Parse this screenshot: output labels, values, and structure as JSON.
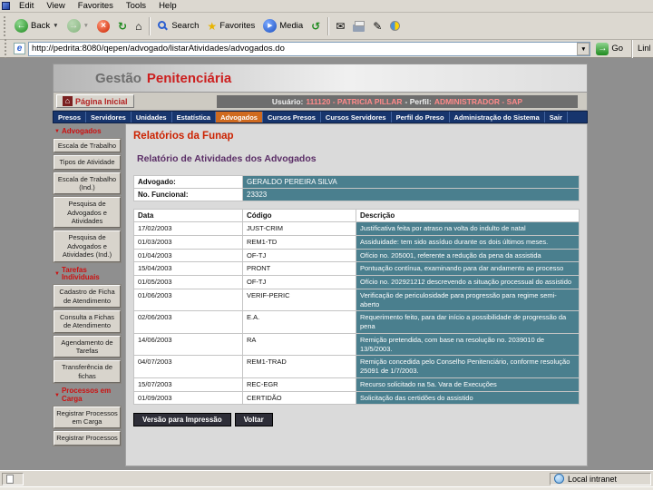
{
  "icons": {
    "back": "←",
    "forward": "→",
    "stop": "×",
    "refresh": "↻",
    "home": "⌂",
    "star": "★",
    "media": "▶",
    "history": "↺",
    "mail": "✉",
    "edit": "✎",
    "dropdown": "▼",
    "go": "→",
    "ie": "e",
    "section_arrow": "▼"
  },
  "browser": {
    "menu": [
      "Edit",
      "View",
      "Favorites",
      "Tools",
      "Help"
    ],
    "toolbar": {
      "back": "Back",
      "search": "Search",
      "favorites": "Favorites",
      "media": "Media"
    },
    "address": {
      "url": "http://pedrita:8080/qepen/advogado/listarAtividades/advogados.do",
      "go": "Go",
      "links": "Links"
    },
    "status": {
      "zone": "Local intranet"
    }
  },
  "app": {
    "brand": {
      "part1": "Gestão",
      "part2": "Penitenciária"
    },
    "home_link": "Página Inicial",
    "user_bar": {
      "label1": "Usuário:",
      "value1": "111120 - PATRICIA PILLAR",
      "label2": "- Perfil:",
      "value2": "ADMINISTRADOR - SAP"
    },
    "nav_tabs": [
      {
        "label": "Presos",
        "active": false
      },
      {
        "label": "Servidores",
        "active": false
      },
      {
        "label": "Unidades",
        "active": false
      },
      {
        "label": "Estatística",
        "active": false
      },
      {
        "label": "Advogados",
        "active": true
      },
      {
        "label": "Cursos Presos",
        "active": false
      },
      {
        "label": "Cursos Servidores",
        "active": false
      },
      {
        "label": "Perfil do Preso",
        "active": false
      },
      {
        "label": "Administração do Sistema",
        "active": false
      },
      {
        "label": "Sair",
        "active": false
      }
    ]
  },
  "sidebar": {
    "sections": [
      {
        "header": "Advogados",
        "items": [
          "Escala de Trabalho",
          "Tipos de Atividade",
          "Escala de Trabalho (Ind.)",
          "Pesquisa de Advogados e Atividades",
          "Pesquisa de Advogados e Atividades (Ind.)"
        ]
      },
      {
        "header": "Tarefas Individuais",
        "items": [
          "Cadastro de Ficha de Atendimento",
          "Consulta a Fichas de Atendimento",
          "Agendamento de Tarefas",
          "Transferência de fichas"
        ]
      },
      {
        "header": "Processos em Carga",
        "items": [
          "Registrar Processos em Carga",
          "Registrar Processos"
        ]
      }
    ]
  },
  "report": {
    "section_title": "Relatórios da Funap",
    "title": "Relatório de Atividades dos Advogados",
    "fields": [
      {
        "label": "Advogado:",
        "value": "GERALDO PEREIRA SILVA"
      },
      {
        "label": "No. Funcional:",
        "value": "23323"
      }
    ],
    "table": {
      "headers": [
        "Data",
        "Código",
        "Descrição"
      ],
      "rows": [
        [
          "17/02/2003",
          "JUST-CRIM",
          "Justificativa feita por atraso na volta do indulto de natal"
        ],
        [
          "01/03/2003",
          "REM1-TD",
          "Assiduidade: tem sido assíduo durante os dois últimos meses."
        ],
        [
          "01/04/2003",
          "OF-TJ",
          "Ofício no. 205001, referente a redução da pena da assistida"
        ],
        [
          "15/04/2003",
          "PRONT",
          "Pontuação contínua, examinando para dar andamento ao processo"
        ],
        [
          "01/05/2003",
          "OF-TJ",
          "Ofício no. 202921212 descrevendo a situação processual do assistido"
        ],
        [
          "01/06/2003",
          "VERIF-PERIC",
          "Verificação de periculosidade para progressão para regime semi-aberto"
        ],
        [
          "02/06/2003",
          "E.A.",
          "Requerimento feito, para dar início a possibilidade de progressão da pena"
        ],
        [
          "14/06/2003",
          "RA",
          "Remição pretendida, com base na resolução no. 2039010 de 13/5/2003."
        ],
        [
          "04/07/2003",
          "REM1-TRAD",
          "Remição concedida pelo Conselho Penitenciário, conforme resolução 25091 de 1/7/2003."
        ],
        [
          "15/07/2003",
          "REC-EGR",
          "Recurso solicitado na 5a. Vara de Execuções"
        ],
        [
          "01/09/2003",
          "CERTIDÃO",
          "Solicitação das certidões do assistido"
        ]
      ]
    },
    "print_label": "Versão para Impressão",
    "back_label": "Voltar"
  },
  "colors": {
    "accent_teal": "#4a7f8e",
    "nav_navy": "#17356d",
    "active_tab_orange": "#cf6a1f",
    "brand_red": "#cc1f1f"
  }
}
